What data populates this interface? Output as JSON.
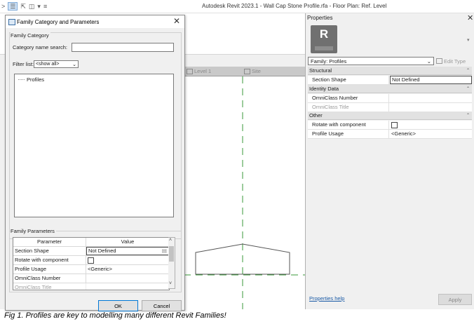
{
  "titlebar": {
    "app_title": "Autodesk Revit 2023.1 - Wall Cap Stone Profile.rfa - Floor Plan: Ref. Level"
  },
  "view_tabs": [
    {
      "label": "Level 1"
    },
    {
      "label": "Site"
    }
  ],
  "family_dialog": {
    "title": "Family Category and Parameters",
    "category_group_label": "Family Category",
    "search_label": "Category name search:",
    "search_value": "",
    "filter_label": "Filter list:",
    "filter_value": "<show all>",
    "tree_items": [
      "Profiles"
    ],
    "parameters_group_label": "Family Parameters",
    "table": {
      "headers": [
        "Parameter",
        "Value"
      ],
      "rows": [
        {
          "name": "Section Shape",
          "value": "Not Defined",
          "kind": "dropdown"
        },
        {
          "name": "Rotate with component",
          "value": "",
          "kind": "checkbox",
          "checked": false
        },
        {
          "name": "Profile Usage",
          "value": "<Generic>",
          "kind": "text"
        },
        {
          "name": "OmniClass Number",
          "value": "",
          "kind": "text"
        },
        {
          "name": "OmniClass Title",
          "value": "",
          "kind": "text"
        }
      ]
    },
    "ok_label": "OK",
    "cancel_label": "Cancel"
  },
  "properties": {
    "title": "Properties",
    "type_selector": "Family: Profiles",
    "edit_type_label": "Edit Type",
    "sections": [
      {
        "name": "Structural",
        "rows": [
          {
            "key": "Section Shape",
            "value": "Not Defined",
            "kind": "boxed"
          }
        ]
      },
      {
        "name": "Identity Data",
        "rows": [
          {
            "key": "OmniClass Number",
            "value": "",
            "kind": "text"
          },
          {
            "key": "OmniClass Title",
            "value": "",
            "kind": "dim"
          }
        ]
      },
      {
        "name": "Other",
        "rows": [
          {
            "key": "Rotate with component",
            "value": "",
            "kind": "checkbox"
          },
          {
            "key": "Profile Usage",
            "value": "<Generic>",
            "kind": "text"
          }
        ]
      }
    ],
    "help_link": "Properties help",
    "apply_label": "Apply"
  },
  "caption": "Fig 1. Profiles are key to modelling many different Revit Families!",
  "colors": {
    "reference_line": "#3a9a3a",
    "accent": "#0078d7",
    "link": "#1a5aa6"
  }
}
